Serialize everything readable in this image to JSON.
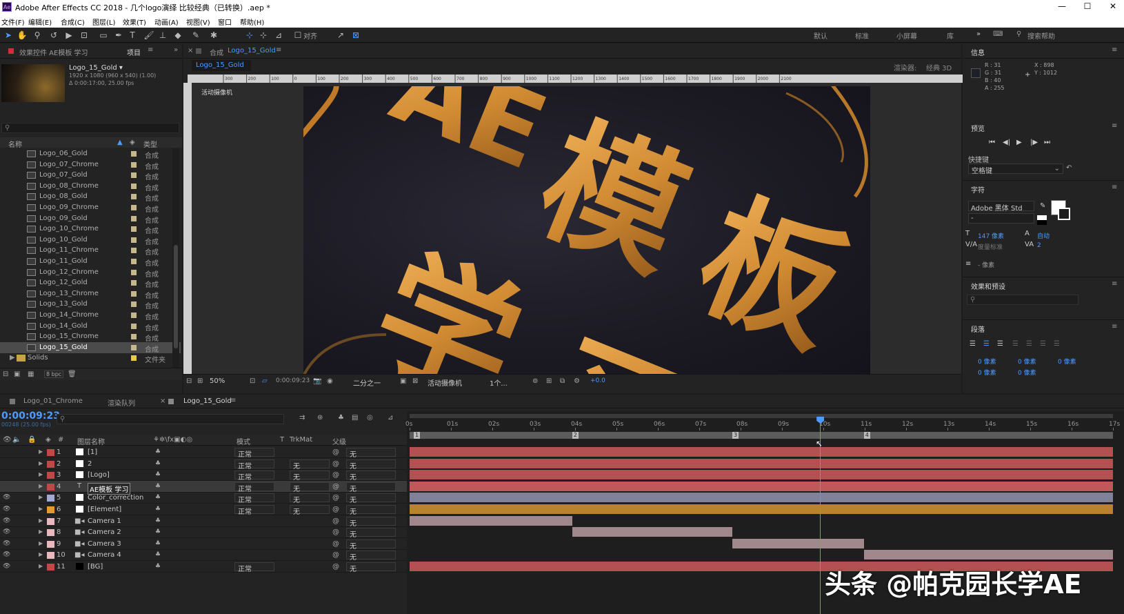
{
  "app": {
    "logo": "Ae",
    "title": "Adobe After Effects CC 2018 - 几个logo演绎 比较经典（已转换）.aep *"
  },
  "window_controls": {
    "minimize": "—",
    "maximize": "☐",
    "close": "✕"
  },
  "menu": [
    "文件(F)",
    "编辑(E)",
    "合成(C)",
    "图层(L)",
    "效果(T)",
    "动画(A)",
    "视图(V)",
    "窗口",
    "帮助(H)"
  ],
  "toolbar": {
    "align_label": "对齐",
    "workspaces": [
      "默认",
      "标准",
      "小屏幕",
      "库"
    ],
    "search_placeholder": "搜索帮助"
  },
  "project_panel": {
    "tab_effects": "效果控件 AE模板 学习",
    "tab_project": "项目",
    "comp_name": "Logo_15_Gold ▾",
    "comp_info1": "1920 x 1080 (960 x 540) (1.00)",
    "comp_info2": "Δ 0:00:17:00, 25.00 fps",
    "col_name": "名称",
    "col_type": "类型",
    "items": [
      {
        "name": "Logo_06_Gold",
        "type": "合成"
      },
      {
        "name": "Logo_07_Chrome",
        "type": "合成"
      },
      {
        "name": "Logo_07_Gold",
        "type": "合成"
      },
      {
        "name": "Logo_08_Chrome",
        "type": "合成"
      },
      {
        "name": "Logo_08_Gold",
        "type": "合成"
      },
      {
        "name": "Logo_09_Chrome",
        "type": "合成"
      },
      {
        "name": "Logo_09_Gold",
        "type": "合成"
      },
      {
        "name": "Logo_10_Chrome",
        "type": "合成"
      },
      {
        "name": "Logo_10_Gold",
        "type": "合成"
      },
      {
        "name": "Logo_11_Chrome",
        "type": "合成"
      },
      {
        "name": "Logo_11_Gold",
        "type": "合成"
      },
      {
        "name": "Logo_12_Chrome",
        "type": "合成"
      },
      {
        "name": "Logo_12_Gold",
        "type": "合成"
      },
      {
        "name": "Logo_13_Chrome",
        "type": "合成"
      },
      {
        "name": "Logo_13_Gold",
        "type": "合成"
      },
      {
        "name": "Logo_14_Chrome",
        "type": "合成"
      },
      {
        "name": "Logo_14_Gold",
        "type": "合成"
      },
      {
        "name": "Logo_15_Chrome",
        "type": "合成"
      },
      {
        "name": "Logo_15_Gold",
        "type": "合成"
      },
      {
        "name": "Solids",
        "type": "文件夹"
      }
    ],
    "bpc": "8 bpc"
  },
  "comp_panel": {
    "tab": "合成",
    "tab_comp": "Logo_15_Gold",
    "breadcrumb": "Logo_15_Gold",
    "renderer_label": "渲染器:",
    "renderer_value": "经典 3D",
    "camera_label": "活动摄像机",
    "ruler_labels": [
      "300",
      "200",
      "100",
      "0",
      "100",
      "200",
      "300",
      "400",
      "500",
      "600",
      "700",
      "800",
      "900",
      "1000",
      "1100",
      "1200",
      "1300",
      "1400",
      "1500",
      "1600",
      "1700",
      "1800",
      "1900",
      "2000",
      "2100"
    ],
    "artwork_text": [
      "AE",
      "模",
      "板",
      "学",
      "习"
    ],
    "zoom": "50%",
    "timecode": "0:00:09:23",
    "resolution": "二分之一",
    "view_camera": "活动摄像机",
    "views": "1个...",
    "exposure": "+0.0"
  },
  "info_panel": {
    "title": "信息",
    "r": "R : 31",
    "g": "G : 31",
    "b": "B : 40",
    "a": "A : 255",
    "x": "X : 898",
    "y": "Y : 1012"
  },
  "preview_panel": {
    "title": "预览",
    "shortcut_label": "快捷键",
    "shortcut_value": "空格键"
  },
  "character_panel": {
    "title": "字符",
    "font": "Adobe 黑体 Std",
    "style": "-",
    "size": "147 像素",
    "leading": "自动",
    "kerning": "度量标准",
    "tracking": "2",
    "stroke": "- 像素"
  },
  "effects_panel": {
    "title": "效果和预设"
  },
  "paragraph_panel": {
    "title": "段落",
    "indent_vals": [
      "0 像素",
      "0 像素",
      "0 像素",
      "0 像素",
      "0 像素"
    ]
  },
  "timeline": {
    "tabs": [
      "Logo_01_Chrome",
      "渲染队列",
      "Logo_15_Gold"
    ],
    "timecode": "0:00:09:23",
    "frame_info": "00248 (25.00 fps)",
    "headers": {
      "num": "#",
      "name": "图层名称",
      "mode": "模式",
      "t": "T",
      "trkmat": "TrkMat",
      "parent": "父级"
    },
    "time_ticks": [
      "0s",
      "01s",
      "02s",
      "03s",
      "04s",
      "05s",
      "06s",
      "07s",
      "08s",
      "09s",
      "10s",
      "11s",
      "12s",
      "13s",
      "14s",
      "15s",
      "16s",
      "17s"
    ],
    "markers": [
      "1",
      "2",
      "3",
      "4"
    ],
    "layers": [
      {
        "num": "1",
        "name": "[1]",
        "mode": "正常",
        "trk": "",
        "parent": "无",
        "color": "#c24747",
        "swatch": "#ffffff",
        "bar": {
          "start": 0,
          "end": 17
        },
        "bar_color": "#b35052"
      },
      {
        "num": "2",
        "name": "2",
        "mode": "正常",
        "trk": "无",
        "parent": "无",
        "color": "#c24747",
        "swatch": "#ffffff",
        "bar": {
          "start": 0,
          "end": 17
        },
        "bar_color": "#b35052"
      },
      {
        "num": "3",
        "name": "[Logo]",
        "mode": "正常",
        "trk": "无",
        "parent": "无",
        "color": "#c24747",
        "swatch": "#ffffff",
        "bar": {
          "start": 0,
          "end": 17
        },
        "bar_color": "#b35052"
      },
      {
        "num": "4",
        "name": "AE模板 学习",
        "mode": "正常",
        "trk": "无",
        "parent": "无",
        "color": "#c24747",
        "swatch": "T",
        "bar": {
          "start": 0,
          "end": 17
        },
        "bar_color": "#c0585a"
      },
      {
        "num": "5",
        "name": "Color_correction",
        "mode": "正常",
        "trk": "无",
        "parent": "无",
        "color": "#a3a8d6",
        "swatch": "#ffffff",
        "bar": {
          "start": 0,
          "end": 17
        },
        "bar_color": "#7f8299"
      },
      {
        "num": "6",
        "name": "[Element]",
        "mode": "正常",
        "trk": "无",
        "parent": "无",
        "color": "#e59a2e",
        "swatch": "#ffffff",
        "bar": {
          "start": 0,
          "end": 17
        },
        "bar_color": "#b8822e"
      },
      {
        "num": "7",
        "name": "Camera 1",
        "mode": "",
        "trk": "",
        "parent": "无",
        "color": "#e8b7bf",
        "swatch": "cam",
        "bar": {
          "start": 0,
          "end": 3.93
        },
        "bar_color": "#a0888c"
      },
      {
        "num": "8",
        "name": "Camera 2",
        "mode": "",
        "trk": "",
        "parent": "无",
        "color": "#e8b7bf",
        "swatch": "cam",
        "bar": {
          "start": 3.93,
          "end": 7.8
        },
        "bar_color": "#a0888c"
      },
      {
        "num": "9",
        "name": "Camera 3",
        "mode": "",
        "trk": "",
        "parent": "无",
        "color": "#e8b7bf",
        "swatch": "cam",
        "bar": {
          "start": 7.8,
          "end": 10.98
        },
        "bar_color": "#a0888c"
      },
      {
        "num": "10",
        "name": "Camera 4",
        "mode": "",
        "trk": "",
        "parent": "无",
        "color": "#e8b7bf",
        "swatch": "cam",
        "bar": {
          "start": 10.98,
          "end": 17
        },
        "bar_color": "#a0888c"
      },
      {
        "num": "11",
        "name": "[BG]",
        "mode": "正常",
        "trk": "",
        "parent": "无",
        "color": "#c24747",
        "swatch": "#000000",
        "bar": {
          "start": 0,
          "end": 17
        },
        "bar_color": "#b35052"
      }
    ],
    "playhead_seconds": 9.92
  },
  "watermark": "头条 @帕克园长学AE"
}
